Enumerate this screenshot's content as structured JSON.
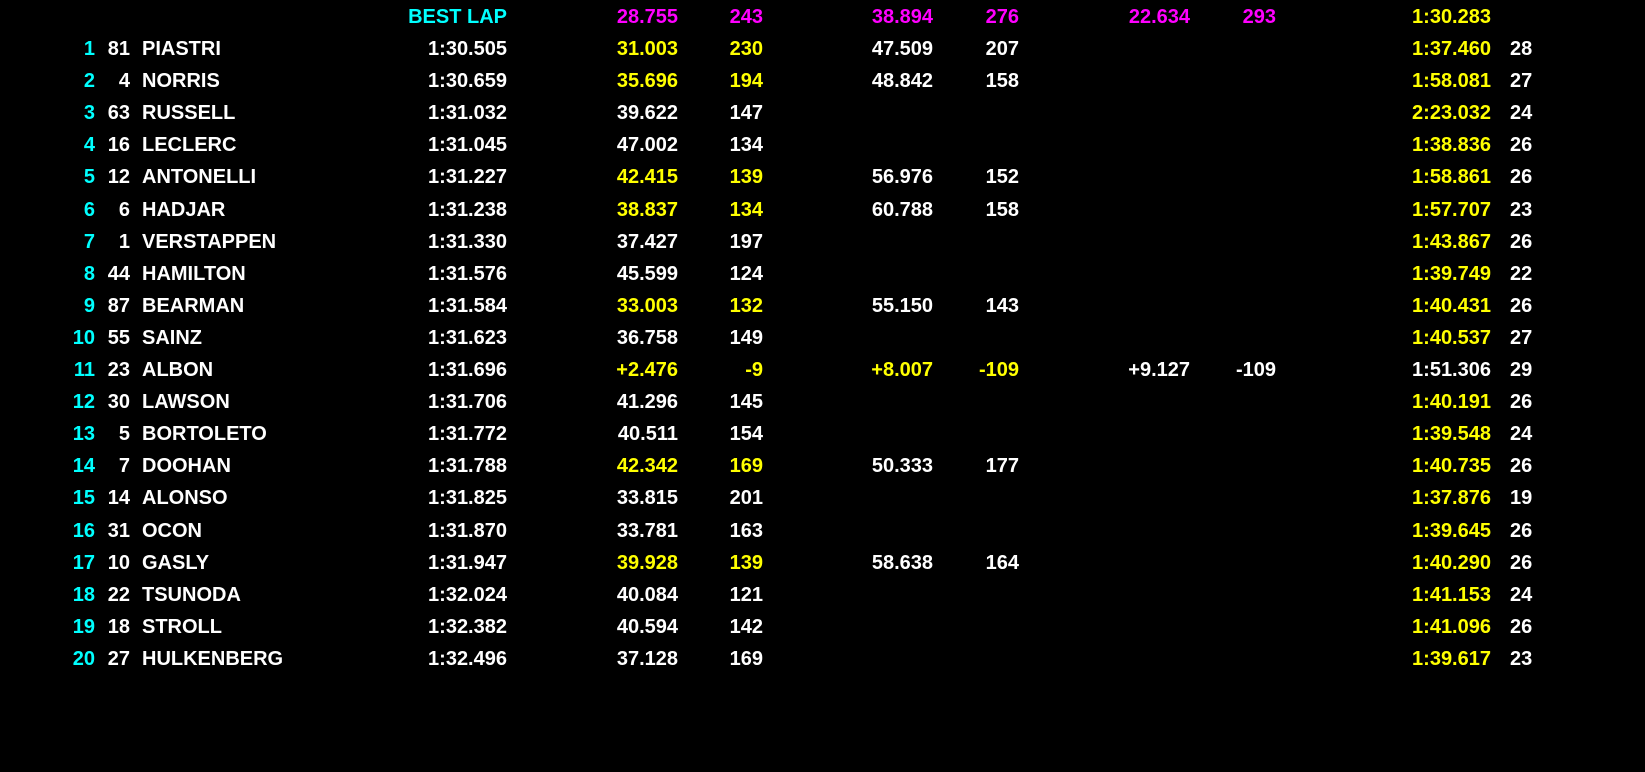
{
  "colors": {
    "background": "#000000",
    "white": "#ffffff",
    "yellow": "#ffff00",
    "magenta": "#ff00ff",
    "cyan": "#00ffff"
  },
  "best_lap": {
    "label": "BEST LAP",
    "s1": "28.755",
    "sp1": "243",
    "s2": "38.894",
    "sp2": "276",
    "s3": "22.634",
    "sp3": "293",
    "lap": "1:30.283"
  },
  "rows": [
    {
      "pos": "1",
      "num": "81",
      "name": "PIASTRI",
      "time": "1:30.505",
      "s1": "31.003",
      "sp1": "230",
      "s2": "47.509",
      "sp2": "207",
      "s3": "",
      "sp3": "",
      "lap": "1:37.460",
      "laps": "28",
      "y1": true,
      "ylap": true
    },
    {
      "pos": "2",
      "num": "4",
      "name": "NORRIS",
      "time": "1:30.659",
      "s1": "35.696",
      "sp1": "194",
      "s2": "48.842",
      "sp2": "158",
      "s3": "",
      "sp3": "",
      "lap": "1:58.081",
      "laps": "27",
      "y1": true,
      "ylap": true
    },
    {
      "pos": "3",
      "num": "63",
      "name": "RUSSELL",
      "time": "1:31.032",
      "s1": "39.622",
      "sp1": "147",
      "s2": "",
      "sp2": "",
      "s3": "",
      "sp3": "",
      "lap": "2:23.032",
      "laps": "24",
      "y1": false,
      "ylap": true
    },
    {
      "pos": "4",
      "num": "16",
      "name": "LECLERC",
      "time": "1:31.045",
      "s1": "47.002",
      "sp1": "134",
      "s2": "",
      "sp2": "",
      "s3": "",
      "sp3": "",
      "lap": "1:38.836",
      "laps": "26",
      "y1": false,
      "ylap": true
    },
    {
      "pos": "5",
      "num": "12",
      "name": "ANTONELLI",
      "time": "1:31.227",
      "s1": "42.415",
      "sp1": "139",
      "s2": "56.976",
      "sp2": "152",
      "s3": "",
      "sp3": "",
      "lap": "1:58.861",
      "laps": "26",
      "y1": true,
      "ylap": true
    },
    {
      "pos": "6",
      "num": "6",
      "name": "HADJAR",
      "time": "1:31.238",
      "s1": "38.837",
      "sp1": "134",
      "s2": "60.788",
      "sp2": "158",
      "s3": "",
      "sp3": "",
      "lap": "1:57.707",
      "laps": "23",
      "y1": true,
      "ylap": true
    },
    {
      "pos": "7",
      "num": "1",
      "name": "VERSTAPPEN",
      "time": "1:31.330",
      "s1": "37.427",
      "sp1": "197",
      "s2": "",
      "sp2": "",
      "s3": "",
      "sp3": "",
      "lap": "1:43.867",
      "laps": "26",
      "y1": false,
      "ylap": true
    },
    {
      "pos": "8",
      "num": "44",
      "name": "HAMILTON",
      "time": "1:31.576",
      "s1": "45.599",
      "sp1": "124",
      "s2": "",
      "sp2": "",
      "s3": "",
      "sp3": "",
      "lap": "1:39.749",
      "laps": "22",
      "y1": false,
      "ylap": true
    },
    {
      "pos": "9",
      "num": "87",
      "name": "BEARMAN",
      "time": "1:31.584",
      "s1": "33.003",
      "sp1": "132",
      "s2": "55.150",
      "sp2": "143",
      "s3": "",
      "sp3": "",
      "lap": "1:40.431",
      "laps": "26",
      "y1": true,
      "ylap": true
    },
    {
      "pos": "10",
      "num": "55",
      "name": "SAINZ",
      "time": "1:31.623",
      "s1": "36.758",
      "sp1": "149",
      "s2": "",
      "sp2": "",
      "s3": "",
      "sp3": "",
      "lap": "1:40.537",
      "laps": "27",
      "y1": false,
      "ylap": true
    },
    {
      "pos": "11",
      "num": "23",
      "name": "ALBON",
      "time": "1:31.696",
      "s1": "+2.476",
      "sp1": "-9",
      "s2": "+8.007",
      "sp2": "-109",
      "s3": "+9.127",
      "sp3": "-109",
      "lap": "1:51.306",
      "laps": "29",
      "y1": true,
      "y2": true,
      "ylap": false
    },
    {
      "pos": "12",
      "num": "30",
      "name": "LAWSON",
      "time": "1:31.706",
      "s1": "41.296",
      "sp1": "145",
      "s2": "",
      "sp2": "",
      "s3": "",
      "sp3": "",
      "lap": "1:40.191",
      "laps": "26",
      "y1": false,
      "ylap": true
    },
    {
      "pos": "13",
      "num": "5",
      "name": "BORTOLETO",
      "time": "1:31.772",
      "s1": "40.511",
      "sp1": "154",
      "s2": "",
      "sp2": "",
      "s3": "",
      "sp3": "",
      "lap": "1:39.548",
      "laps": "24",
      "y1": false,
      "ylap": true
    },
    {
      "pos": "14",
      "num": "7",
      "name": "DOOHAN",
      "time": "1:31.788",
      "s1": "42.342",
      "sp1": "169",
      "s2": "50.333",
      "sp2": "177",
      "s3": "",
      "sp3": "",
      "lap": "1:40.735",
      "laps": "26",
      "y1": true,
      "ylap": true
    },
    {
      "pos": "15",
      "num": "14",
      "name": "ALONSO",
      "time": "1:31.825",
      "s1": "33.815",
      "sp1": "201",
      "s2": "",
      "sp2": "",
      "s3": "",
      "sp3": "",
      "lap": "1:37.876",
      "laps": "19",
      "y1": false,
      "ylap": true
    },
    {
      "pos": "16",
      "num": "31",
      "name": "OCON",
      "time": "1:31.870",
      "s1": "33.781",
      "sp1": "163",
      "s2": "",
      "sp2": "",
      "s3": "",
      "sp3": "",
      "lap": "1:39.645",
      "laps": "26",
      "y1": false,
      "ylap": true
    },
    {
      "pos": "17",
      "num": "10",
      "name": "GASLY",
      "time": "1:31.947",
      "s1": "39.928",
      "sp1": "139",
      "s2": "58.638",
      "sp2": "164",
      "s3": "",
      "sp3": "",
      "lap": "1:40.290",
      "laps": "26",
      "y1": true,
      "ylap": true
    },
    {
      "pos": "18",
      "num": "22",
      "name": "TSUNODA",
      "time": "1:32.024",
      "s1": "40.084",
      "sp1": "121",
      "s2": "",
      "sp2": "",
      "s3": "",
      "sp3": "",
      "lap": "1:41.153",
      "laps": "24",
      "y1": false,
      "ylap": true
    },
    {
      "pos": "19",
      "num": "18",
      "name": "STROLL",
      "time": "1:32.382",
      "s1": "40.594",
      "sp1": "142",
      "s2": "",
      "sp2": "",
      "s3": "",
      "sp3": "",
      "lap": "1:41.096",
      "laps": "26",
      "y1": false,
      "ylap": true
    },
    {
      "pos": "20",
      "num": "27",
      "name": "HULKENBERG",
      "time": "1:32.496",
      "s1": "37.128",
      "sp1": "169",
      "s2": "",
      "sp2": "",
      "s3": "",
      "sp3": "",
      "lap": "1:39.617",
      "laps": "23",
      "y1": false,
      "ylap": true
    }
  ]
}
